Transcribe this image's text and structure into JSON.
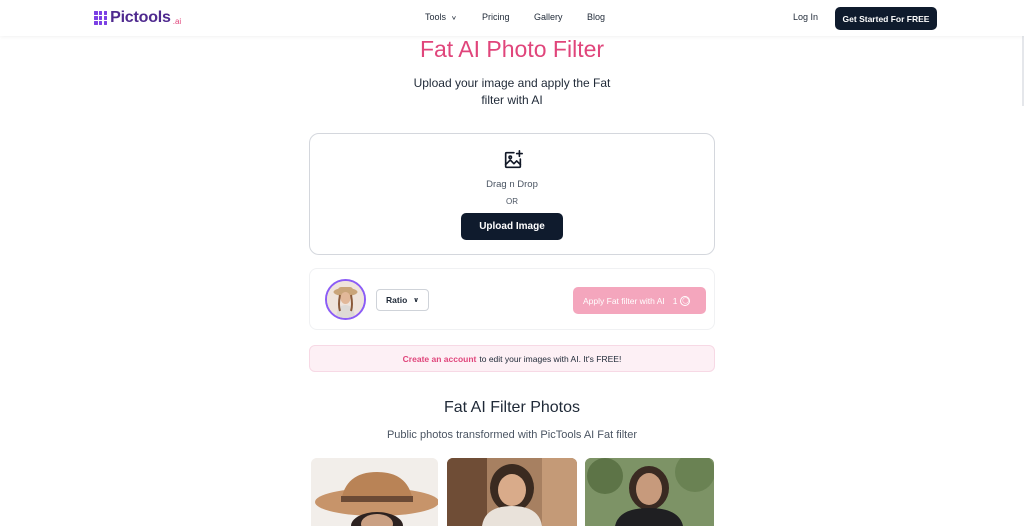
{
  "header": {
    "logo_text": "Pictools",
    "logo_suffix": ".ai",
    "nav": {
      "tools": "Tools",
      "pricing": "Pricing",
      "gallery": "Gallery",
      "blog": "Blog"
    },
    "login": "Log In",
    "cta": "Get Started For FREE"
  },
  "hero": {
    "title": "Fat AI Photo Filter",
    "subtitle": "Upload your image and apply the Fat filter with AI"
  },
  "upload": {
    "drag_text": "Drag n Drop",
    "or_text": "OR",
    "button": "Upload Image"
  },
  "options": {
    "ratio_label": "Ratio",
    "apply_label": "Apply Fat filter with AI",
    "apply_cost": "1"
  },
  "notice": {
    "link_text": "Create an account",
    "text": "to edit your images with AI. It's FREE!"
  },
  "gallery": {
    "title": "Fat AI Filter Photos",
    "subtitle": "Public photos transformed with PicTools AI Fat filter"
  },
  "colors": {
    "accent_pink": "#e0457b",
    "dark_button": "#0f1b2d",
    "apply_disabled": "#f4a6bd",
    "logo_purple": "#4f2a8f"
  }
}
